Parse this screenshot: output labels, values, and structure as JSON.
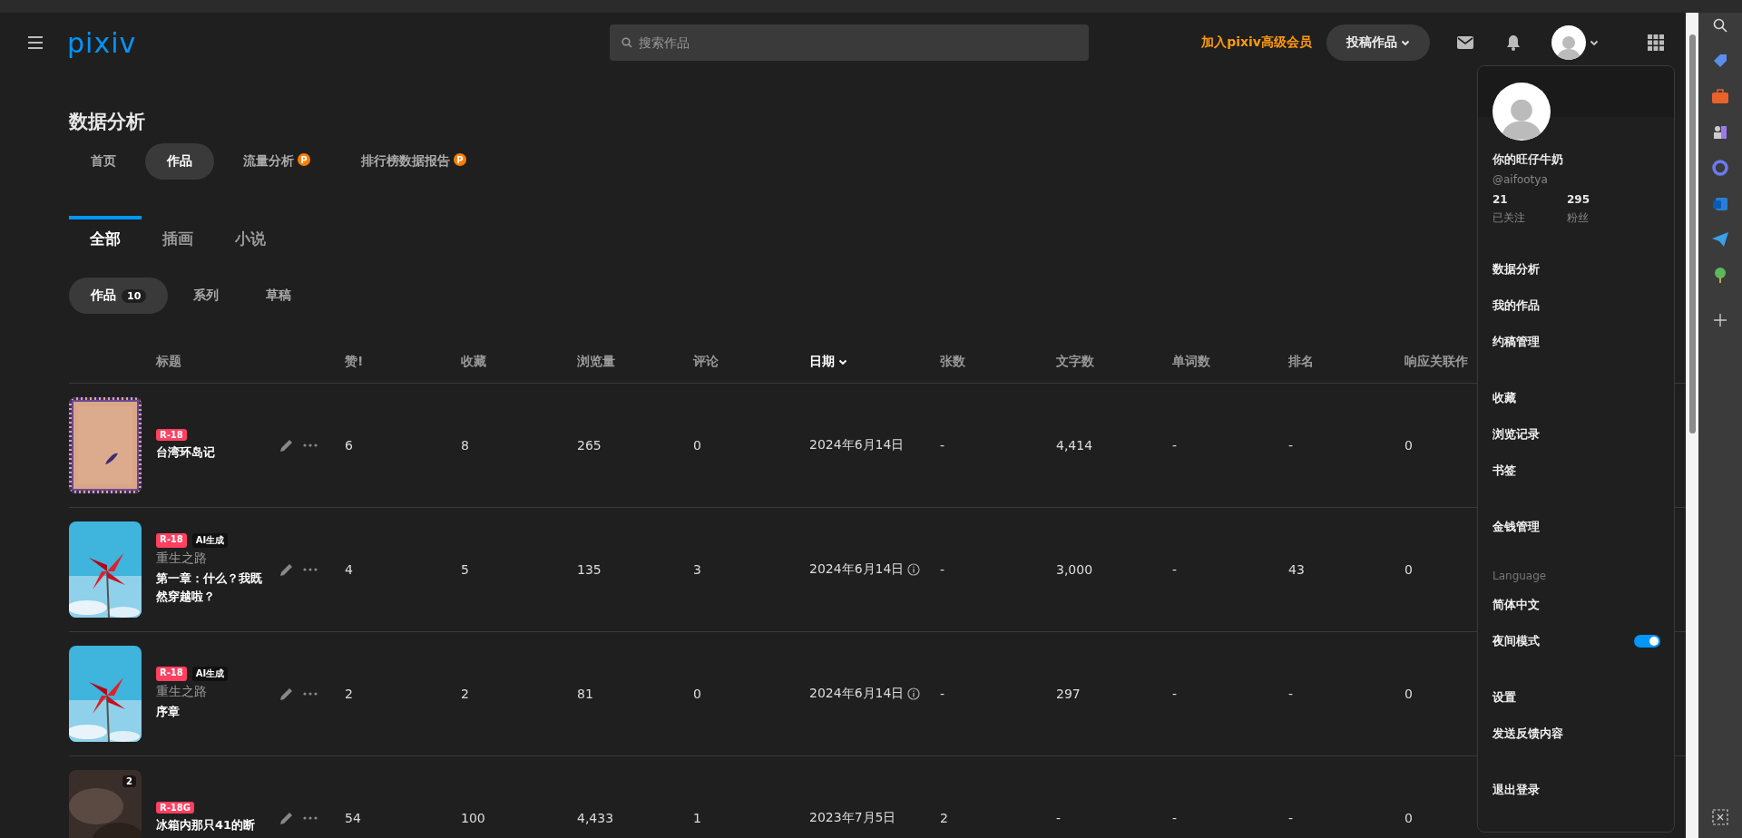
{
  "header": {
    "logo": "pixiv",
    "search": {
      "placeholder": "搜索作品"
    },
    "premium_link": "加入pixiv高级会员",
    "post_button": "投稿作品"
  },
  "page": {
    "title": "数据分析",
    "tabs": [
      {
        "label": "首页",
        "selected": false
      },
      {
        "label": "作品",
        "selected": true
      },
      {
        "label": "流量分析",
        "selected": false,
        "badge": "P"
      },
      {
        "label": "排行榜数据报告",
        "selected": false,
        "badge": "P"
      }
    ],
    "type_tabs": [
      {
        "label": "全部",
        "selected": true
      },
      {
        "label": "插画",
        "selected": false
      },
      {
        "label": "小说",
        "selected": false
      }
    ],
    "sub_tabs": [
      {
        "label": "作品",
        "selected": true,
        "count": "10"
      },
      {
        "label": "系列",
        "selected": false
      },
      {
        "label": "草稿",
        "selected": false
      }
    ]
  },
  "table": {
    "title_header": "标题",
    "columns": [
      {
        "label": "赞!",
        "sorted": false
      },
      {
        "label": "收藏",
        "sorted": false
      },
      {
        "label": "浏览量",
        "sorted": false
      },
      {
        "label": "评论",
        "sorted": false
      },
      {
        "label": "日期",
        "sorted": true
      },
      {
        "label": "张数",
        "sorted": false
      },
      {
        "label": "文字数",
        "sorted": false
      },
      {
        "label": "单词数",
        "sorted": false
      },
      {
        "label": "排名",
        "sorted": false
      },
      {
        "label": "响应关联作",
        "sorted": false
      }
    ],
    "rows": [
      {
        "tags": [
          {
            "label": "R-18",
            "kind": "rating"
          }
        ],
        "title": "台湾环岛记",
        "date_info": false,
        "cells": [
          "6",
          "8",
          "265",
          "0",
          "2024年6月14日",
          "-",
          "4,414",
          "-",
          "-",
          "0"
        ]
      },
      {
        "tags": [
          {
            "label": "R-18",
            "kind": "rating"
          },
          {
            "label": "AI生成",
            "kind": "ai"
          }
        ],
        "series": "重生之路",
        "title": "第一章：什么？我既然穿越啦？",
        "date_info": true,
        "cells": [
          "4",
          "5",
          "135",
          "3",
          "2024年6月14日",
          "-",
          "3,000",
          "-",
          "43",
          "0"
        ]
      },
      {
        "tags": [
          {
            "label": "R-18",
            "kind": "rating"
          },
          {
            "label": "AI生成",
            "kind": "ai"
          }
        ],
        "series": "重生之路",
        "title": "序章",
        "date_info": true,
        "cells": [
          "2",
          "2",
          "81",
          "0",
          "2024年6月14日",
          "-",
          "297",
          "-",
          "-",
          "0"
        ]
      },
      {
        "tags": [
          {
            "label": "R-18G",
            "kind": "rating"
          }
        ],
        "pages_badge": "2",
        "title": "冰箱内那只41的断",
        "date_info": false,
        "cells": [
          "54",
          "100",
          "4,433",
          "1",
          "2023年7月5日",
          "2",
          "-",
          "-",
          "-",
          "0"
        ]
      }
    ]
  },
  "menu": {
    "name": "你的旺仔牛奶",
    "handle": "@aifootya",
    "stats": [
      {
        "value": "21",
        "label": "已关注"
      },
      {
        "value": "295",
        "label": "粉丝"
      }
    ],
    "groups": [
      {
        "items": [
          {
            "label": "数据分析",
            "kind": "link"
          },
          {
            "label": "我的作品",
            "kind": "link"
          },
          {
            "label": "约稿管理",
            "kind": "link"
          }
        ]
      },
      {
        "items": [
          {
            "label": "收藏",
            "kind": "link"
          },
          {
            "label": "浏览记录",
            "kind": "link"
          },
          {
            "label": "书签",
            "kind": "link"
          }
        ]
      },
      {
        "items": [
          {
            "label": "金钱管理",
            "kind": "link"
          }
        ]
      },
      {
        "heading": "Language",
        "items": [
          {
            "label": "简体中文",
            "kind": "link"
          },
          {
            "label": "夜间模式",
            "kind": "toggle",
            "on": true
          }
        ]
      },
      {
        "items": [
          {
            "label": "设置",
            "kind": "link"
          },
          {
            "label": "发送反馈内容",
            "kind": "link"
          }
        ]
      },
      {
        "items": [
          {
            "label": "退出登录",
            "kind": "link"
          }
        ]
      }
    ]
  }
}
